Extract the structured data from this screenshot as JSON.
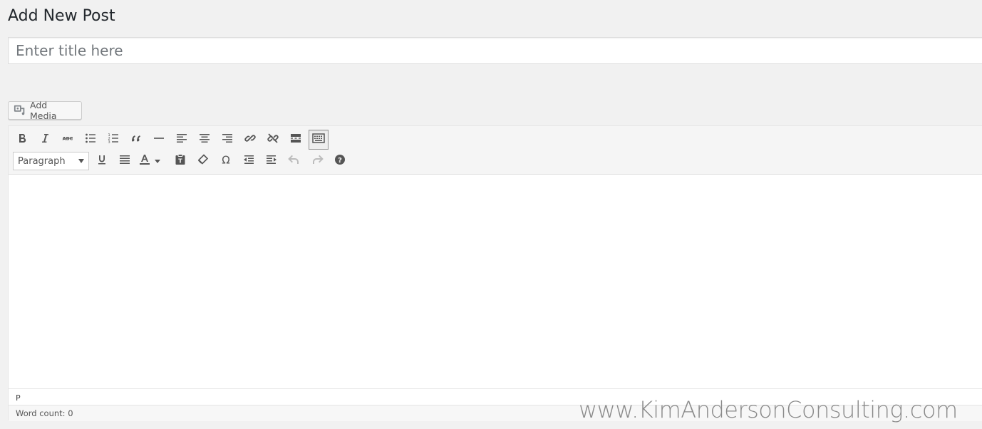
{
  "page": {
    "title": "Add New Post"
  },
  "post_title": {
    "placeholder": "Enter title here",
    "value": ""
  },
  "add_media": {
    "label": "Add Media",
    "icon": "add-media-icon"
  },
  "toolbar": {
    "row1": [
      "bold-icon",
      "italic-icon",
      "strikethrough-icon",
      "bulleted-list-icon",
      "numbered-list-icon",
      "blockquote-icon",
      "horizontal-line-icon",
      "align-left-icon",
      "align-center-icon",
      "align-right-icon",
      "insert-link-icon",
      "remove-link-icon",
      "read-more-icon",
      "toolbar-toggle-icon"
    ],
    "format_select": {
      "value": "Paragraph"
    },
    "row2": [
      "underline-icon",
      "justify-icon",
      "text-color-icon",
      "paste-as-text-icon",
      "clear-formatting-icon",
      "special-character-icon",
      "decrease-indent-icon",
      "increase-indent-icon",
      "undo-icon",
      "redo-icon",
      "help-icon"
    ]
  },
  "editor": {
    "path": "P",
    "word_count_label": "Word count:",
    "word_count": "0",
    "word_count_text": "Word count: 0"
  },
  "watermark": "www.KimAndersonConsulting.com"
}
